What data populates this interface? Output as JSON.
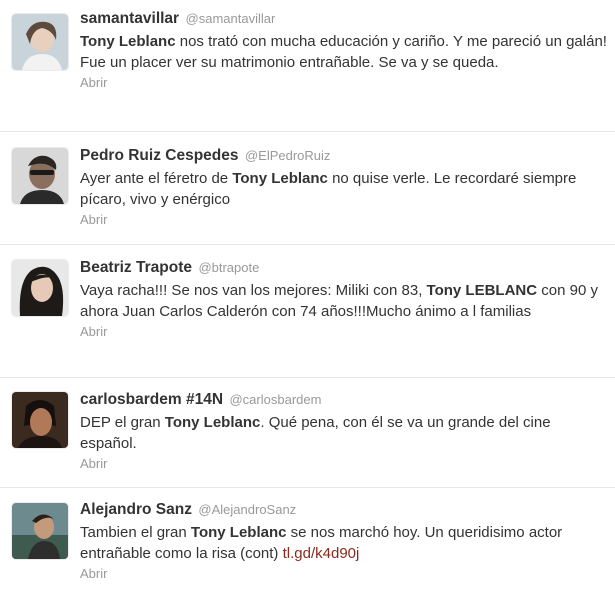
{
  "tweets": [
    {
      "name": "samantavillar",
      "handle": "@samantavillar",
      "text_parts": [
        {
          "bold": true,
          "text": "Tony Leblanc"
        },
        {
          "bold": false,
          "text": " nos trató con mucha educación y cariño. Y me pareció un galán! Fue un placer ver su matrimonio entrañable. Se va y se queda."
        }
      ],
      "action": "Abrir"
    },
    {
      "name": "Pedro Ruiz Cespedes",
      "handle": "@ElPedroRuiz",
      "text_parts": [
        {
          "bold": false,
          "text": "Ayer ante el féretro de "
        },
        {
          "bold": true,
          "text": "Tony Leblanc"
        },
        {
          "bold": false,
          "text": " no quise verle. Le recordaré siempre pícaro, vivo y enérgico"
        }
      ],
      "action": "Abrir"
    },
    {
      "name": "Beatriz Trapote",
      "handle": "@btrapote",
      "text_parts": [
        {
          "bold": false,
          "text": "Vaya racha!!! Se nos van los mejores: Miliki con 83, "
        },
        {
          "bold": true,
          "text": "Tony LEBLANC"
        },
        {
          "bold": false,
          "text": " con 90 y ahora Juan Carlos Calderón con 74 años!!!Mucho ánimo a l familias"
        }
      ],
      "action": "Abrir"
    },
    {
      "name": "carlosbardem #14N",
      "handle": "@carlosbardem",
      "text_parts": [
        {
          "bold": false,
          "text": "DEP el gran "
        },
        {
          "bold": true,
          "text": "Tony Leblanc"
        },
        {
          "bold": false,
          "text": ". Qué pena, con él se va un grande del cine español."
        }
      ],
      "action": "Abrir"
    },
    {
      "name": "Alejandro Sanz",
      "handle": "@AlejandroSanz",
      "text_parts": [
        {
          "bold": false,
          "text": "Tambien el gran "
        },
        {
          "bold": true,
          "text": "Tony Leblanc"
        },
        {
          "bold": false,
          "text": " se nos marchó hoy. Un queridisimo actor entrañable como la risa (cont) "
        },
        {
          "link": true,
          "text": "tl.gd/k4d90j"
        }
      ],
      "action": "Abrir"
    }
  ],
  "colors": {
    "name": "#333333",
    "handle": "#999999",
    "link": "#8a2a1c",
    "divider": "#e6e6e6"
  }
}
